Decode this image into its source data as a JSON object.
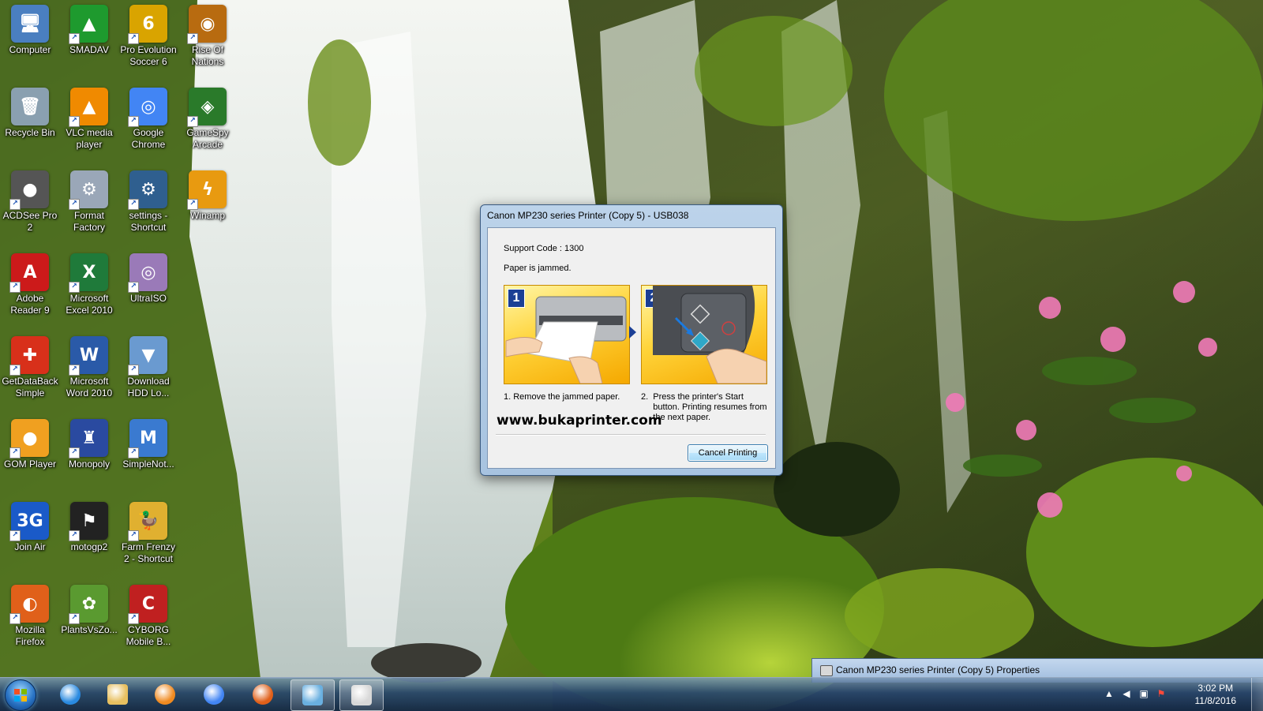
{
  "desktop": {
    "icons": [
      {
        "label": "Computer",
        "icon": "computer-icon",
        "color": "#4a7fc0"
      },
      {
        "label": "SMADAV",
        "icon": "smadav-icon",
        "color": "#1e9a2e"
      },
      {
        "label": "Pro Evolution\nSoccer 6",
        "icon": "pes6-icon",
        "color": "#d9a400"
      },
      {
        "label": "Rise Of\nNations",
        "icon": "rise-of-nations-icon",
        "color": "#b86b10"
      },
      {
        "label": "Recycle Bin",
        "icon": "recycle-bin-icon",
        "color": "#8aa0b0"
      },
      {
        "label": "VLC media\nplayer",
        "icon": "vlc-icon",
        "color": "#f08a00"
      },
      {
        "label": "Google\nChrome",
        "icon": "chrome-icon",
        "color": "#4285f4"
      },
      {
        "label": "GameSpy\nArcade",
        "icon": "gamespy-icon",
        "color": "#2a7a2a"
      },
      {
        "label": "ACDSee Pro 2",
        "icon": "acdsee-icon",
        "color": "#555555"
      },
      {
        "label": "Format\nFactory",
        "icon": "format-factory-icon",
        "color": "#9aa7b8"
      },
      {
        "label": "settings -\nShortcut",
        "icon": "settings-icon",
        "color": "#2f5f8f"
      },
      {
        "label": "Winamp",
        "icon": "winamp-icon",
        "color": "#e89a10"
      },
      {
        "label": "Adobe\nReader 9",
        "icon": "adobe-reader-icon",
        "color": "#cc1a1a"
      },
      {
        "label": "Microsoft\nExcel 2010",
        "icon": "excel-icon",
        "color": "#1f7a3a"
      },
      {
        "label": "UltraISO",
        "icon": "ultraiso-icon",
        "color": "#9a7ab8"
      },
      {
        "label": "GetDataBack\nSimple",
        "icon": "getdataback-icon",
        "color": "#d8301a"
      },
      {
        "label": "Microsoft\nWord 2010",
        "icon": "word-icon",
        "color": "#2a5aa8"
      },
      {
        "label": "Download\nHDD Lo...",
        "icon": "download-hdd-icon",
        "color": "#6a9ad0"
      },
      {
        "label": "GOM Player",
        "icon": "gom-player-icon",
        "color": "#f0a020"
      },
      {
        "label": "Monopoly",
        "icon": "monopoly-icon",
        "color": "#2a4aa0"
      },
      {
        "label": "SimpleNot...",
        "icon": "simplenote-icon",
        "color": "#3a7ad0"
      },
      {
        "label": "Join Air",
        "icon": "join-air-icon",
        "color": "#1a5ac8"
      },
      {
        "label": "motogp2",
        "icon": "motogp-icon",
        "color": "#222222"
      },
      {
        "label": "Farm Frenzy\n2 - Shortcut",
        "icon": "farm-frenzy-icon",
        "color": "#e0b030"
      },
      {
        "label": "Mozilla\nFirefox",
        "icon": "firefox-icon",
        "color": "#e0601a"
      },
      {
        "label": "PlantsVsZo...",
        "icon": "plants-vs-zombies-icon",
        "color": "#5a9a30"
      },
      {
        "label": "CYBORG\nMobile B...",
        "icon": "cyborg-icon",
        "color": "#c02020"
      }
    ],
    "icon_glyphs": [
      "🖥",
      "▲",
      "6",
      "◉",
      "🗑",
      "▲",
      "◎",
      "◈",
      "●",
      "⚙",
      "⚙",
      "ϟ",
      "A",
      "X",
      "◎",
      "✚",
      "W",
      "▼",
      "●",
      "♜",
      "M",
      "3G",
      "⚑",
      "🦆",
      "◐",
      "✿",
      "C"
    ]
  },
  "dialog": {
    "title": "Canon MP230 series Printer (Copy 5) - USB038",
    "support_code": "Support Code : 1300",
    "message": "Paper is jammed.",
    "steps": [
      {
        "number": "1",
        "caption": "1.  Remove the jammed paper."
      },
      {
        "number": "2",
        "caption": "2.  Press the printer's Start\n     button. Printing resumes from\n     the next paper."
      }
    ],
    "watermark": "www.bukaprinter.com",
    "cancel_button": "Cancel Printing"
  },
  "properties_window": {
    "title": "Canon MP230 series Printer (Copy 5) Properties"
  },
  "taskbar": {
    "pinned": [
      {
        "name": "internet-explorer-icon",
        "color": "#2a8ae0"
      },
      {
        "name": "windows-explorer-icon",
        "color": "#e8c060"
      },
      {
        "name": "media-player-icon",
        "color": "#f08a20"
      },
      {
        "name": "chrome-icon",
        "color": "#4285f4"
      },
      {
        "name": "firefox-icon",
        "color": "#e0601a"
      },
      {
        "name": "control-panel-icon",
        "color": "#6ab0e0"
      },
      {
        "name": "printer-queue-icon",
        "color": "#d8d8d8"
      }
    ],
    "clock": {
      "time": "3:02 PM",
      "date": "11/8/2016"
    }
  }
}
